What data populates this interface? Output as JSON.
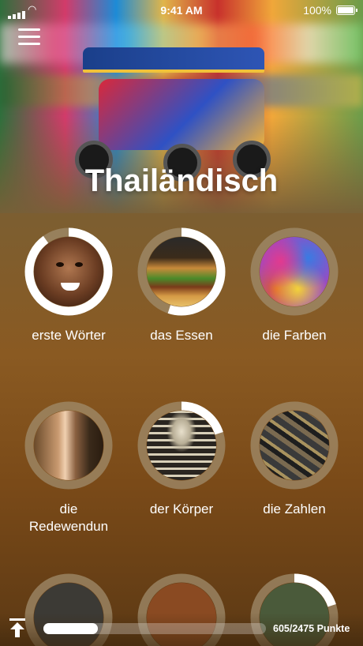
{
  "status_bar": {
    "time": "9:41 AM",
    "battery": "100%"
  },
  "menu": {
    "icon": "hamburger-icon"
  },
  "page": {
    "title": "Thailändisch"
  },
  "categories": [
    {
      "label": "erste Wörter",
      "progress": 0.9,
      "image": "child-face-photo"
    },
    {
      "label": "das Essen",
      "progress": 0.55,
      "image": "burger-fries-photo"
    },
    {
      "label": "die Farben",
      "progress": 0.0,
      "image": "color-powder-photo"
    },
    {
      "label": "die Redewendun",
      "label_line1": "die",
      "label_line2": "Redewendun",
      "progress": 0.0,
      "image": "two-people-photo"
    },
    {
      "label": "der Körper",
      "progress": 0.2,
      "image": "skeleton-photo"
    },
    {
      "label": "die Zahlen",
      "progress": 0.0,
      "image": "metal-numbers-photo"
    }
  ],
  "partial_row_progress": [
    0.0,
    0.0,
    0.2
  ],
  "progress": {
    "current": 605,
    "total": 2475,
    "text": "605/2475 Punkte",
    "fraction": 0.2444
  },
  "colors": {
    "ring_track": "#a08c6c",
    "ring_fill": "#ffffff",
    "accent": "#ffffff"
  }
}
